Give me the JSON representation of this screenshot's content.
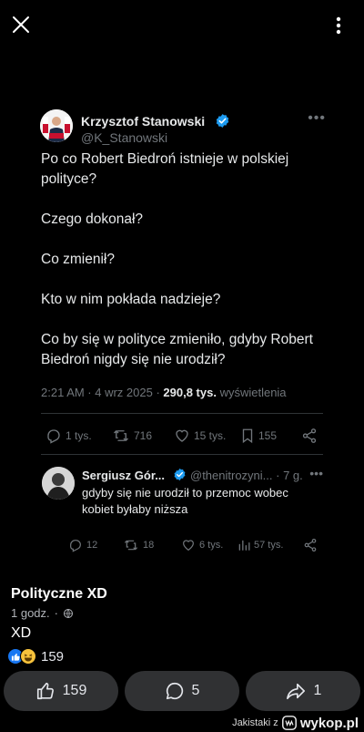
{
  "tweet": {
    "author_name": "Krzysztof Stanowski",
    "author_handle": "@K_Stanowski",
    "paragraphs": [
      "Po co Robert Biedroń istnieje w polskiej polityce?",
      "Czego dokonał?",
      "Co zmienił?",
      "Kto w nim pokłada nadzieje?",
      "Co by się w polityce zmieniło, gdyby Robert Biedroń nigdy się nie urodził?"
    ],
    "time": "2:21 AM · 4 wrz 2025 · ",
    "views_count": "290,8 tys.",
    "views_label": " wyświetlenia",
    "replies": "1 tys.",
    "reposts": "716",
    "likes": "15 tys.",
    "bookmarks": "155"
  },
  "reply": {
    "author_name": "Sergiusz Gór...",
    "author_handle": "@thenitrozyni... · 7 g.",
    "text": "gdyby się nie urodził to przemoc wobec kobiet byłaby niższa",
    "replies": "12",
    "reposts": "18",
    "likes": "6 tys.",
    "views": "57 tys."
  },
  "post": {
    "title": "Polityczne XD",
    "time": "1 godz.",
    "separator": "·",
    "body": "XD",
    "reaction_count": "159"
  },
  "actions": {
    "like_count": "159",
    "comment_count": "5",
    "share_count": "1"
  },
  "footer": {
    "user_text": "Jakistaki z",
    "brand": "wykop.pl"
  },
  "icons": {
    "close": "close-icon",
    "more": "more-vertical-icon",
    "verified": "verified-badge-icon",
    "reply": "reply-icon",
    "repost": "repost-icon",
    "like": "heart-icon",
    "bookmark": "bookmark-icon",
    "share": "share-icon",
    "views": "views-icon",
    "globe": "globe-icon",
    "thumb": "thumbs-up-icon",
    "comment": "comment-icon",
    "forward": "forward-icon"
  },
  "colors": {
    "background": "#000000",
    "verified": "#1d9bf0",
    "muted": "#71767b",
    "button_bg": "#303133",
    "like_reaction": "#1877f2",
    "haha_reaction": "#f7c33c"
  }
}
